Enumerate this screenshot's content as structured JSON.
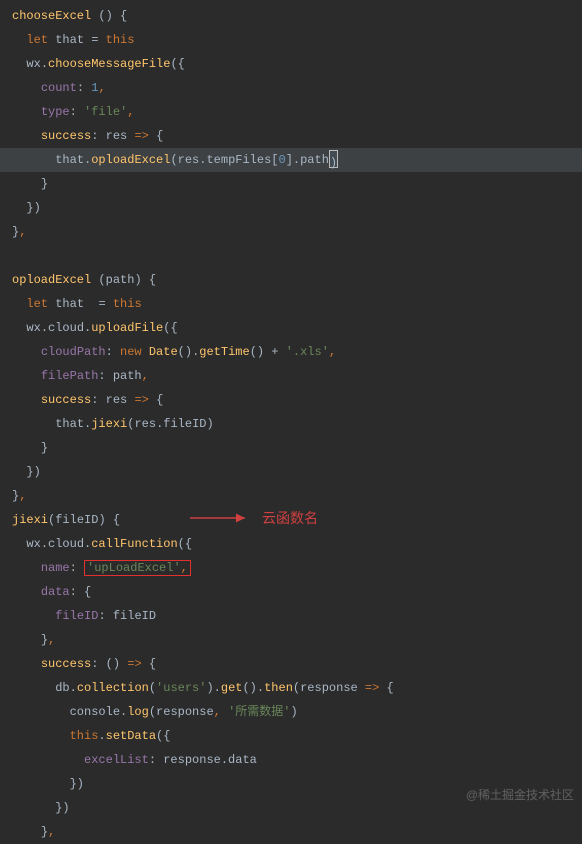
{
  "code": {
    "chooseExcel_name": "chooseExcel",
    "let": "let",
    "that": "that",
    "equals": "=",
    "this": "this",
    "wx": "wx",
    "chooseMessageFile": "chooseMessageFile",
    "count_key": "count",
    "count_val": "1",
    "type_key": "type",
    "type_val": "'file'",
    "success_key": "success",
    "res": "res",
    "arrow": "=>",
    "oploadExcel_call": "oploadExcel",
    "tempFiles": "tempFiles",
    "zero": "0",
    "path_prop": "path",
    "oploadExcel_name": "oploadExcel",
    "path_param": "path",
    "cloud": "cloud",
    "uploadFile": "uploadFile",
    "cloudPath_key": "cloudPath",
    "new": "new",
    "Date": "Date",
    "getTime": "getTime",
    "xls": "'.xls'",
    "filePath_key": "filePath",
    "jiexi_call": "jiexi",
    "fileID_prop": "fileID",
    "jiexi_name": "jiexi",
    "fileID_param": "fileID",
    "callFunction": "callFunction",
    "name_key": "name",
    "upLoadExcel_str": "'upLoadExcel'",
    "data_key": "data",
    "fileID_key": "fileID",
    "db": "db",
    "collection": "collection",
    "users_str": "'users'",
    "get": "get",
    "then": "then",
    "response": "response",
    "console": "console",
    "log": "log",
    "needed_data_str": "'所需数据'",
    "setData": "setData",
    "excelList_key": "excelList",
    "data_prop": "data"
  },
  "annotation": {
    "label": "云函数名"
  },
  "watermark": "@稀土掘金技术社区"
}
